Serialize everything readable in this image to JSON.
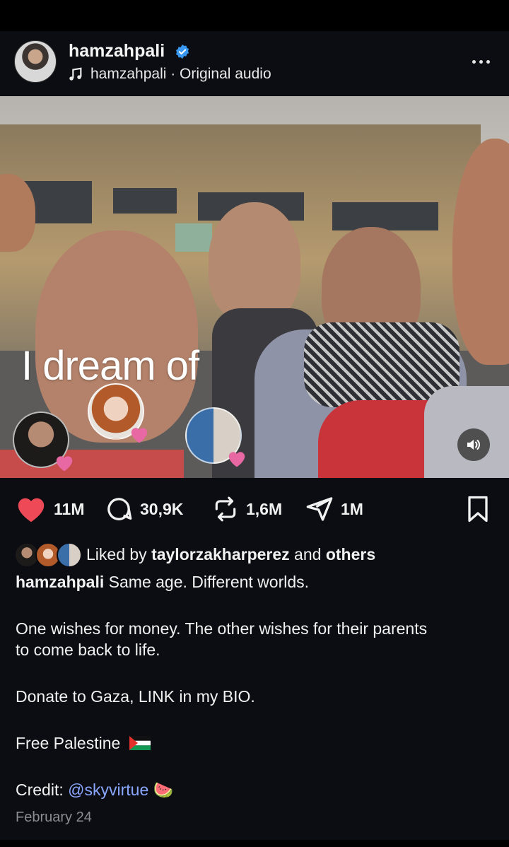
{
  "header": {
    "username": "hamzahpali",
    "verified": true,
    "audio_label": "hamzahpali · Original audio",
    "more_icon": "more-horizontal-icon"
  },
  "media": {
    "overlay_text": "I dream of",
    "sound_icon": "speaker-on-icon"
  },
  "actions": {
    "likes": "11M",
    "comments": "30,9K",
    "reposts": "1,6M",
    "shares": "1M",
    "like_color": "#ed4956"
  },
  "liked_by": {
    "prefix": "Liked by",
    "user": "taylorzakharperez",
    "and": "and",
    "others": "others"
  },
  "caption": {
    "author": "hamzahpali",
    "line1": "Same age. Different worlds.",
    "para2": "One wishes for money. The other wishes for their parents to come back to life.",
    "para3": "Donate to Gaza, LINK in my BIO.",
    "para4": "Free Palestine",
    "credit_label": "Credit:",
    "credit_handle": "@skyvirtue",
    "credit_emoji": "🍉"
  },
  "date": "February 24",
  "colors": {
    "background": "#0c0d12",
    "verified_blue": "#3897f0",
    "link_blue": "#8aa7ff",
    "muted": "#8c8c92"
  }
}
